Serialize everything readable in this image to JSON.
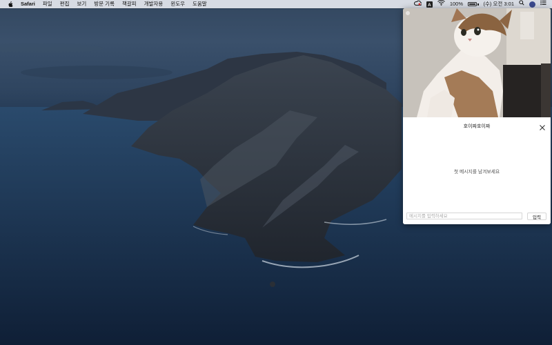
{
  "menubar": {
    "apple_icon": "apple-logo-icon",
    "app_name": "Safari",
    "menus": [
      "파일",
      "편집",
      "보기",
      "방문 기록",
      "책갈피",
      "개발자용",
      "윈도우",
      "도움말"
    ],
    "status": {
      "input_source": "A",
      "battery_percent": "100%",
      "datetime": "(수) 오전 3:01",
      "icons": [
        "creative-cloud-icon",
        "wifi-icon",
        "battery-icon",
        "search-icon",
        "user-avatar-icon",
        "control-center-icon"
      ]
    }
  },
  "chat_window": {
    "title": "호이짜호이짜",
    "empty_message": "첫 메시지를 남겨보세요",
    "input_placeholder": "메시지를 입력하세요",
    "input_value": "",
    "send_label": "입력"
  },
  "colors": {
    "menubar_bg": "#d7dbe3",
    "panel_bg": "#ffffff",
    "sea": "#1c3250"
  }
}
